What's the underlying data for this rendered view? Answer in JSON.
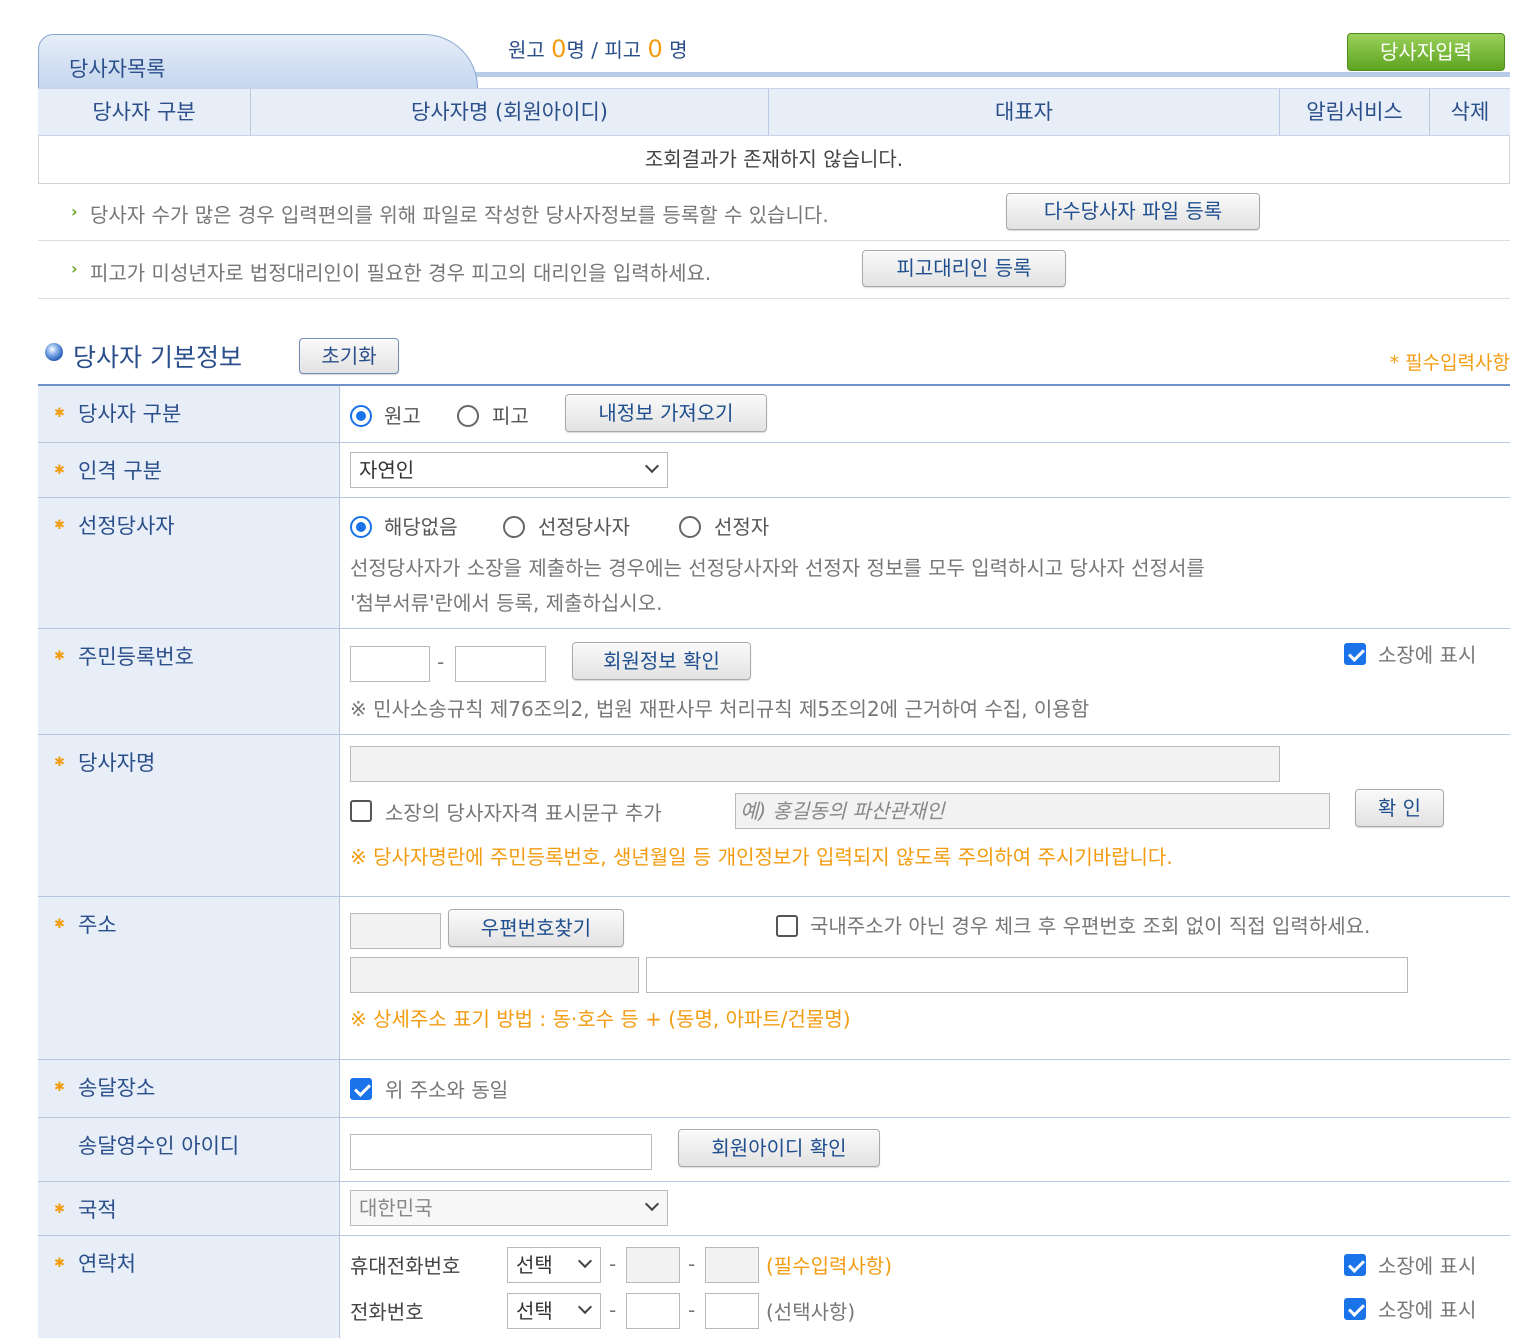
{
  "list": {
    "tab_title": "당사자목록",
    "counts": {
      "plaintiff_label": "원고",
      "plaintiff_count": "0",
      "unit1": "명",
      "sep": "/",
      "defendant_label": "피고",
      "defendant_count": "0",
      "unit2": "명"
    },
    "add_button": "당사자입력",
    "columns": [
      "당사자 구분",
      "당사자명 (회원아이디)",
      "대표자",
      "알림서비스",
      "삭제"
    ],
    "empty_text": "조회결과가 존재하지 않습니다.",
    "info1": {
      "text": "당사자 수가 많은 경우 입력편의를 위해 파일로 작성한 당사자정보를 등록할 수 있습니다.",
      "button": "다수당사자 파일 등록"
    },
    "info2": {
      "text": "피고가 미성년자로 법정대리인이 필요한 경우 피고의 대리인을 입력하세요.",
      "button": "피고대리인 등록"
    }
  },
  "section": {
    "title": "당사자 기본정보",
    "reset_button": "초기화",
    "required_note": "* 필수입력사항"
  },
  "form": {
    "party_type": {
      "label": "당사자 구분",
      "options": [
        "원고",
        "피고"
      ],
      "selected": "원고",
      "button": "내정보 가져오기"
    },
    "person_type": {
      "label": "인격 구분",
      "value": "자연인"
    },
    "selected_party": {
      "label": "선정당사자",
      "options": [
        "해당없음",
        "선정당사자",
        "선정자"
      ],
      "selected": "해당없음",
      "desc1": "선정당사자가 소장을 제출하는 경우에는 선정당사자와 선정자 정보를 모두 입력하시고 당사자 선정서를",
      "desc2": "'첨부서류'란에서 등록, 제출하십시오."
    },
    "rrn": {
      "label": "주민등록번호",
      "dash": "-",
      "button": "회원정보 확인",
      "show_label": "소장에 표시",
      "show_checked": true,
      "note": "※ 민사소송규칙 제76조의2, 법원 재판사무 처리규칙 제5조의2에 근거하여 수집, 이용함"
    },
    "name": {
      "label": "당사자명",
      "qual_label": "소장의 당사자자격 표시문구 추가",
      "qual_placeholder": "예) 홍길동의 파산관재인",
      "confirm": "확 인",
      "warning": "※ 당사자명란에 주민등록번호, 생년월일 등 개인정보가 입력되지 않도록 주의하여 주시기바랍니다."
    },
    "address": {
      "label": "주소",
      "zip_button": "우편번호찾기",
      "foreign_label": "국내주소가 아닌 경우 체크 후 우편번호 조회 없이 직접 입력하세요.",
      "note": "※ 상세주소 표기 방법 : 동·호수 등 + (동명, 아파트/건물명)"
    },
    "delivery": {
      "label": "송달장소",
      "same_label": "위 주소와 동일",
      "same_checked": true
    },
    "receiver": {
      "label": "송달영수인 아이디",
      "button": "회원아이디 확인"
    },
    "nationality": {
      "label": "국적",
      "value": "대한민국"
    },
    "contact": {
      "label": "연락처",
      "mobile": {
        "label": "휴대전화번호",
        "select": "선택",
        "dash": "-",
        "note": "(필수입력사항)",
        "show_label": "소장에 표시"
      },
      "phone": {
        "label": "전화번호",
        "select": "선택",
        "dash": "-",
        "note": "(선택사항)",
        "show_label": "소장에 표시"
      }
    }
  }
}
